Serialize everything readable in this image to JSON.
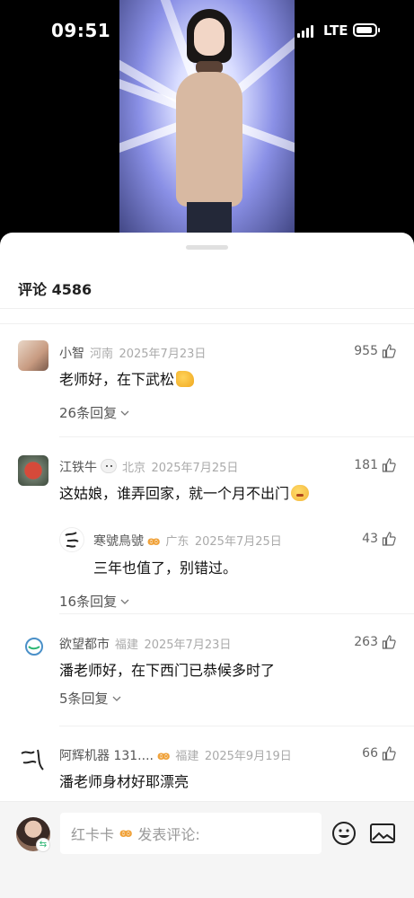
{
  "status_bar": {
    "time": "09:51",
    "network": "LTE"
  },
  "sheet": {
    "title": "评论 4586"
  },
  "comments": [
    {
      "user": "小智",
      "location": "河南",
      "date": "2025年7月23日",
      "text": "老师好，在下武松",
      "likes": "955",
      "replies": "26条回复"
    },
    {
      "user": "江铁牛",
      "location": "北京",
      "date": "2025年7月25日",
      "text": "这姑娘，谁弄回家，就一个月不出门",
      "likes": "181",
      "reply": {
        "user": "寒號鳥號",
        "badge": "ꙭ",
        "location": "广东",
        "date": "2025年7月25日",
        "text": "三年也值了，别错过。",
        "likes": "43"
      },
      "replies": "16条回复"
    },
    {
      "user": "欲望都市",
      "location": "福建",
      "date": "2025年7月23日",
      "text": "潘老师好，在下西门已恭候多时了",
      "likes": "263",
      "replies": "5条回复"
    },
    {
      "user": "阿辉机器 131....",
      "badge": "ꙭ",
      "location": "福建",
      "date": "2025年9月19日",
      "text": "潘老师身材好耶漂亮",
      "likes": "66"
    }
  ],
  "input": {
    "prefix": "红卡卡",
    "badge": "ꙭ",
    "placeholder": "发表评论:"
  },
  "icons": {
    "like": "thumb-up-icon",
    "chevron": "chevron-down-icon",
    "emoji": "emoji-icon",
    "image": "image-icon"
  },
  "colors": {
    "badge": "#f0a23a",
    "meta": "#aaaaaa",
    "text": "#111111"
  }
}
